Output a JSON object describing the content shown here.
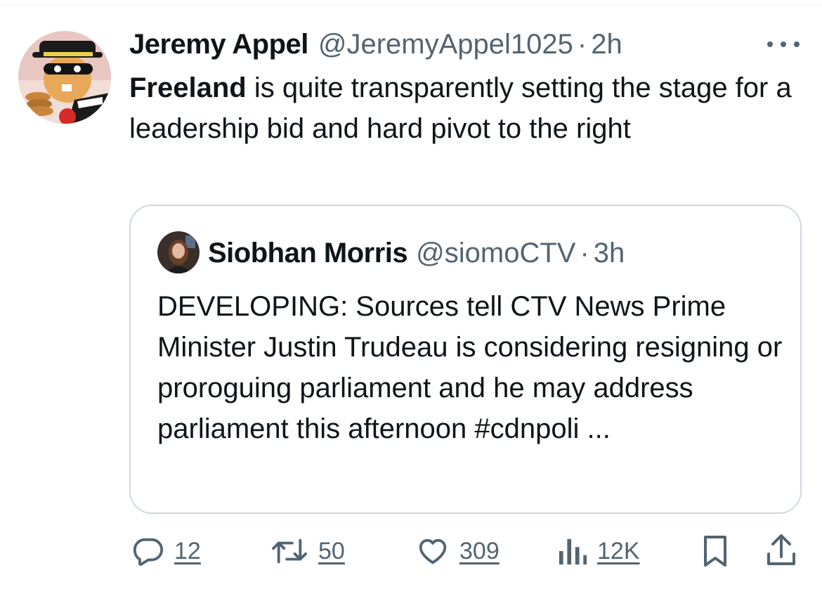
{
  "tweet": {
    "author_name": "Jeremy Appel",
    "author_handle": "@JeremyAppel1025",
    "separator": "·",
    "time": "2h",
    "text_bold": "Freeland",
    "text_rest": " is quite transparently setting the stage for a leadership bid and hard pivot to the right",
    "avatar_icon": "hamburglar-avatar",
    "more_icon": "more-horizontal-icon"
  },
  "quote": {
    "author_name": "Siobhan Morris",
    "author_handle": "@siomoCTV",
    "separator": "·",
    "time": "3h",
    "text": "DEVELOPING: Sources tell CTV News Prime Minister Justin Trudeau is considering resigning or proroguing parliament and he may address parliament this afternoon #cdnpoli ...",
    "avatar_icon": "reporter-avatar"
  },
  "actions": {
    "replies": "12",
    "retweets": "50",
    "likes": "309",
    "views": "12K",
    "icons": [
      "reply-icon",
      "retweet-icon",
      "like-icon",
      "views-icon",
      "bookmark-icon",
      "share-icon"
    ]
  },
  "colors": {
    "text_primary": "#0f1419",
    "text_secondary": "#536471",
    "border": "#cfd9de"
  }
}
